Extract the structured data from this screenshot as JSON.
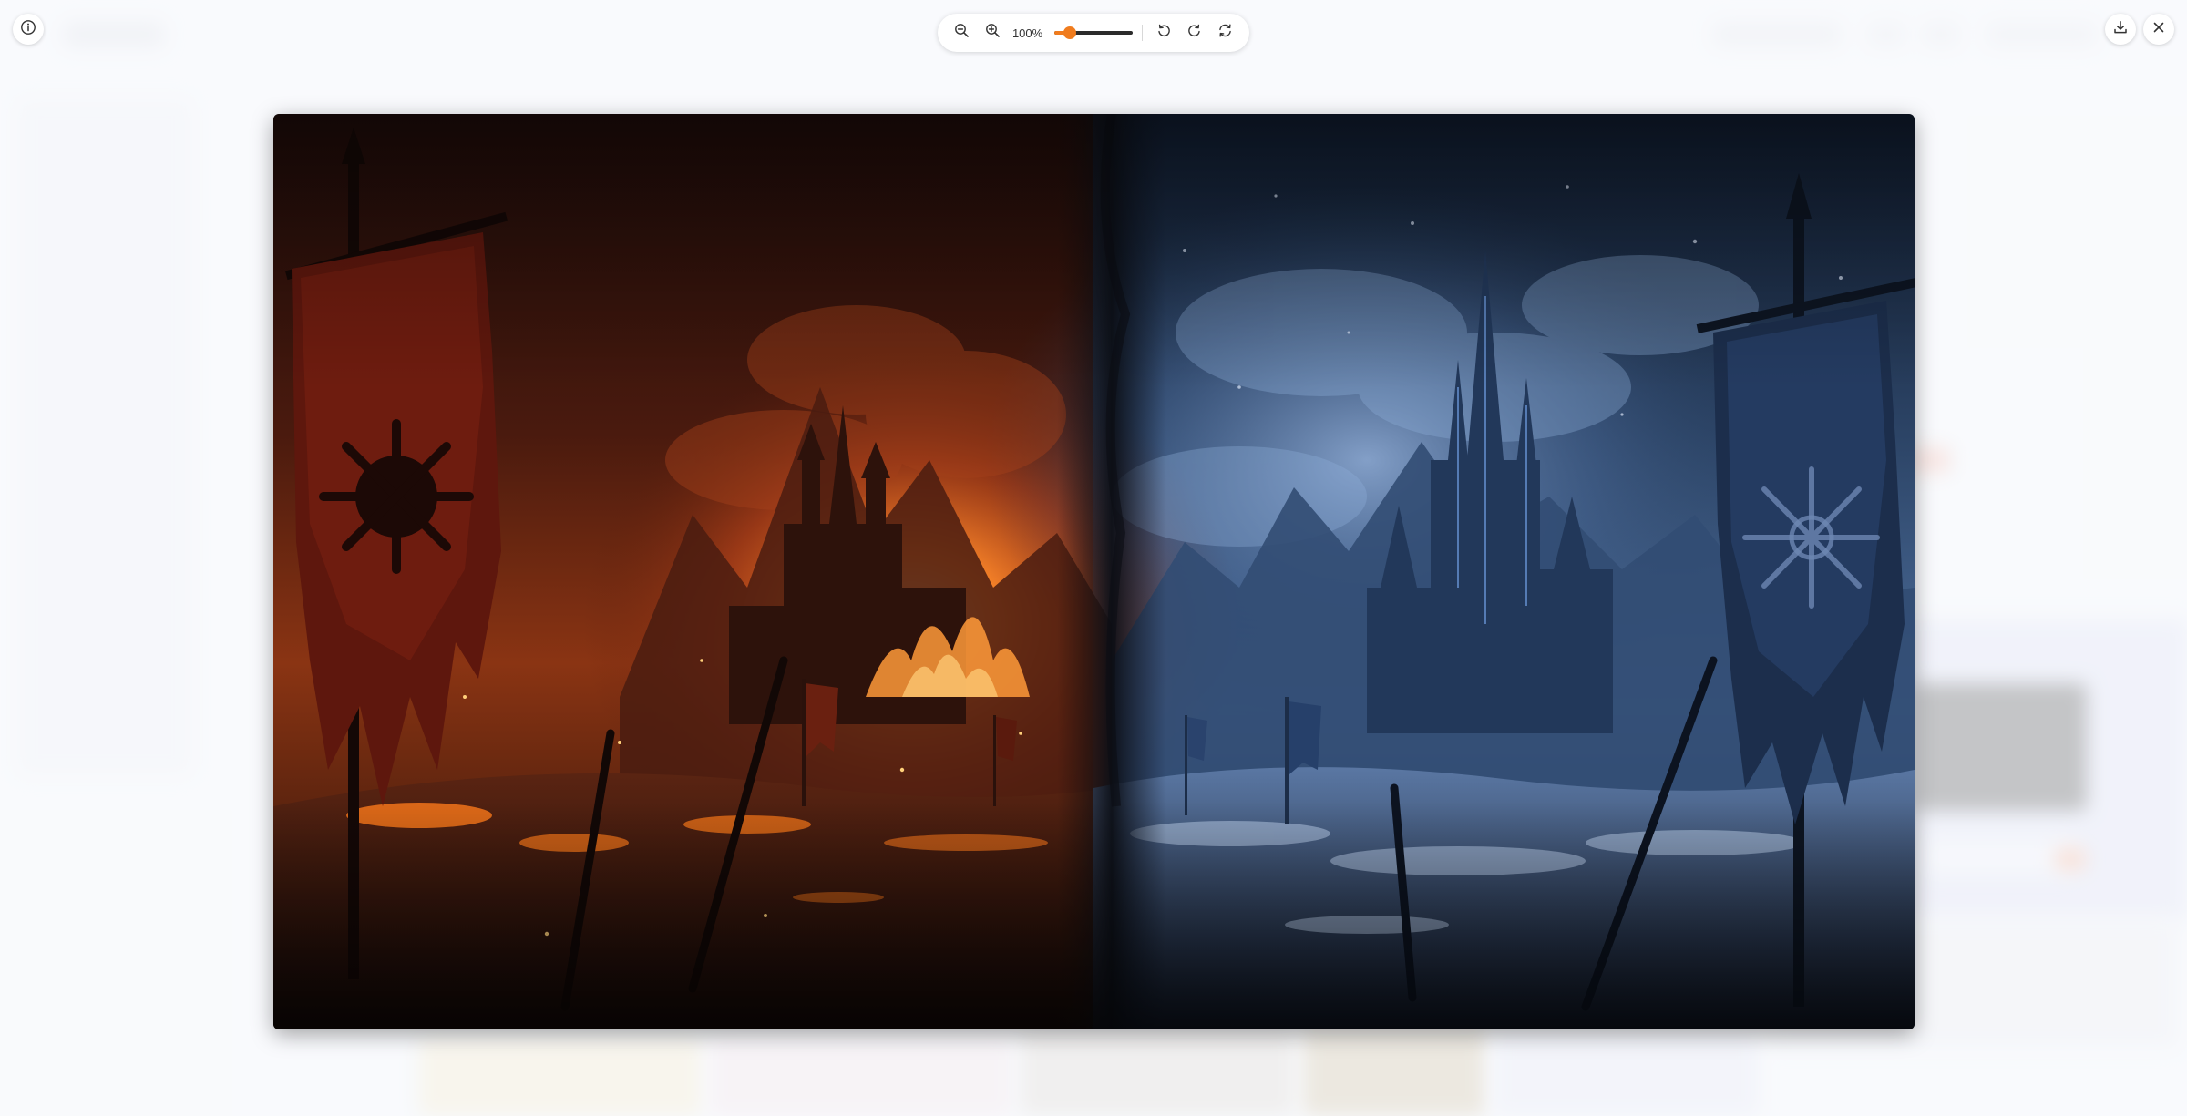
{
  "viewer": {
    "zoom_label": "100%",
    "zoom_fraction": 0.2
  },
  "icons": {
    "info": "info-circle-icon",
    "zoom_out": "zoom-out-icon",
    "zoom_in": "zoom-in-icon",
    "rotate_left": "rotate-left-icon",
    "rotate_right": "rotate-right-icon",
    "reset": "reset-icon",
    "download": "download-icon",
    "close": "close-icon"
  },
  "colors": {
    "accent": "#f07c1e",
    "fire": "#ff7a1a",
    "ice": "#5d86c4"
  }
}
